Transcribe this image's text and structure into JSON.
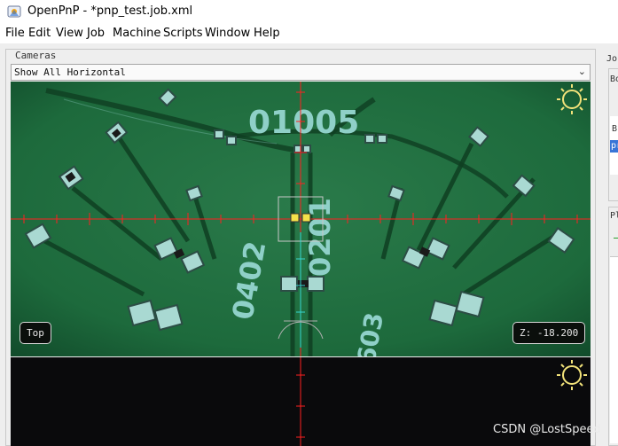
{
  "window": {
    "title": "OpenPnP - *pnp_test.job.xml"
  },
  "menu": [
    "File",
    "Edit",
    "View",
    "Job",
    "Machine",
    "Scripts",
    "Window",
    "Help"
  ],
  "cameras": {
    "section_title": "Cameras",
    "view_mode": "Show All Horizontal",
    "top_view": {
      "name_label": "Top",
      "z_readout": "Z: -18.200",
      "pcb_labels": [
        "01005",
        "0201",
        "0402",
        "603"
      ]
    }
  },
  "right_panel": {
    "job_tab": "Jo",
    "boards_label": "Bo",
    "row_b": "B",
    "row_pr": "pr",
    "placements_label": "Pl"
  },
  "watermark": "CSDN @LostSpeed",
  "colors": {
    "pcb_green": "#1f6b3e",
    "crosshair_red": "#ff1f1f",
    "reticle_cyan": "#36d6d0",
    "sun_yellow": "#f2e27a"
  }
}
